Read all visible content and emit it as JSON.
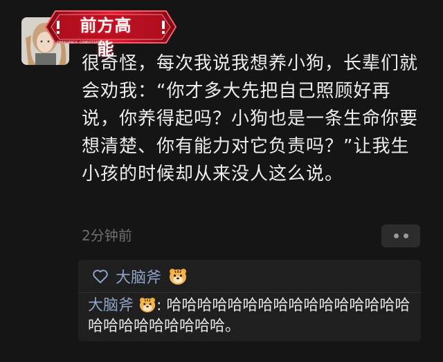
{
  "comment": {
    "banner_title": "前方高能",
    "banner_subtitle": "EMERGENCY CONDITION RED",
    "text": "很奇怪，每次我说我想养小狗，长辈们就会劝我：“你才多大先把自己照顾好再说，你养得起吗？小狗也是一条生命你要想清楚、你有能力对它负责吗？”让我生小孩的时候却从来没人这么说。",
    "timestamp": "2分钟前"
  },
  "likes": {
    "user": "大脑斧"
  },
  "reply": {
    "author": "大脑斧",
    "separator": ": ",
    "text": "哈哈哈哈哈哈哈哈哈哈哈哈哈哈哈哈哈哈哈哈哈哈哈哈哈。"
  },
  "colors": {
    "background": "#151515",
    "accent_red": "#e8182f",
    "username_blue": "#8fa3c8"
  },
  "icons": {
    "heart": "heart-outline-icon",
    "tiger": "tiger-emoji-icon",
    "more": "more-dots-icon"
  }
}
